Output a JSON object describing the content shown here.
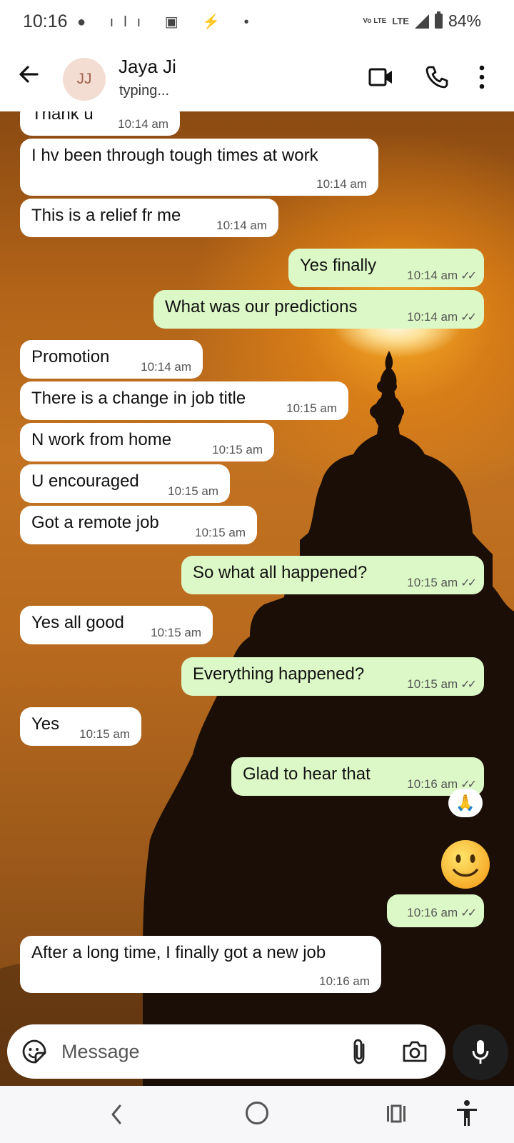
{
  "status_bar": {
    "time": "10:16",
    "network": "LTE",
    "volte": "Vo LTE",
    "battery": "84%"
  },
  "header": {
    "avatar_initials": "JJ",
    "contact_name": "Jaya Ji",
    "contact_status": "typing..."
  },
  "messages": [
    {
      "dir": "in",
      "text": "Thank u",
      "time": "10:14 am"
    },
    {
      "dir": "in",
      "text": "I hv been through tough times at work",
      "time": "10:14 am"
    },
    {
      "dir": "in",
      "text": "This is a relief fr me",
      "time": "10:14 am"
    },
    {
      "dir": "out",
      "text": "Yes finally",
      "time": "10:14 am"
    },
    {
      "dir": "out",
      "text": "What was our predictions",
      "time": "10:14 am"
    },
    {
      "dir": "in",
      "text": "Promotion",
      "time": "10:14 am"
    },
    {
      "dir": "in",
      "text": "There is a change in job title",
      "time": "10:15 am"
    },
    {
      "dir": "in",
      "text": "N work from home",
      "time": "10:15 am"
    },
    {
      "dir": "in",
      "text": "U encouraged",
      "time": "10:15 am"
    },
    {
      "dir": "in",
      "text": "Got a remote job",
      "time": "10:15 am"
    },
    {
      "dir": "out",
      "text": "So what all happened?",
      "time": "10:15 am"
    },
    {
      "dir": "in",
      "text": "Yes all good",
      "time": "10:15 am"
    },
    {
      "dir": "out",
      "text": "Everything happened?",
      "time": "10:15 am"
    },
    {
      "dir": "in",
      "text": "Yes",
      "time": "10:15 am"
    },
    {
      "dir": "out",
      "text": "Glad to hear that",
      "time": "10:16 am",
      "reaction": "🙏"
    },
    {
      "dir": "out",
      "text": "",
      "time": "10:16 am",
      "emoji": "slightly-smiling-face"
    },
    {
      "dir": "in",
      "text": "After a long time, I finally got a new job",
      "time": "10:16 am"
    }
  ],
  "input": {
    "placeholder": "Message"
  },
  "icons": {
    "back": "arrow-left-icon",
    "video": "video-camera-icon",
    "call": "phone-icon",
    "menu": "more-vertical-icon",
    "sticker": "sticker-icon",
    "attach": "paperclip-icon",
    "camera": "camera-icon",
    "mic": "microphone-icon",
    "read_receipt": "double-check-icon"
  },
  "colors": {
    "incoming_bubble": "#ffffff",
    "outgoing_bubble": "#dcf8c6",
    "mic_button": "#1e1e1e",
    "avatar_bg": "#f3dcd2"
  }
}
